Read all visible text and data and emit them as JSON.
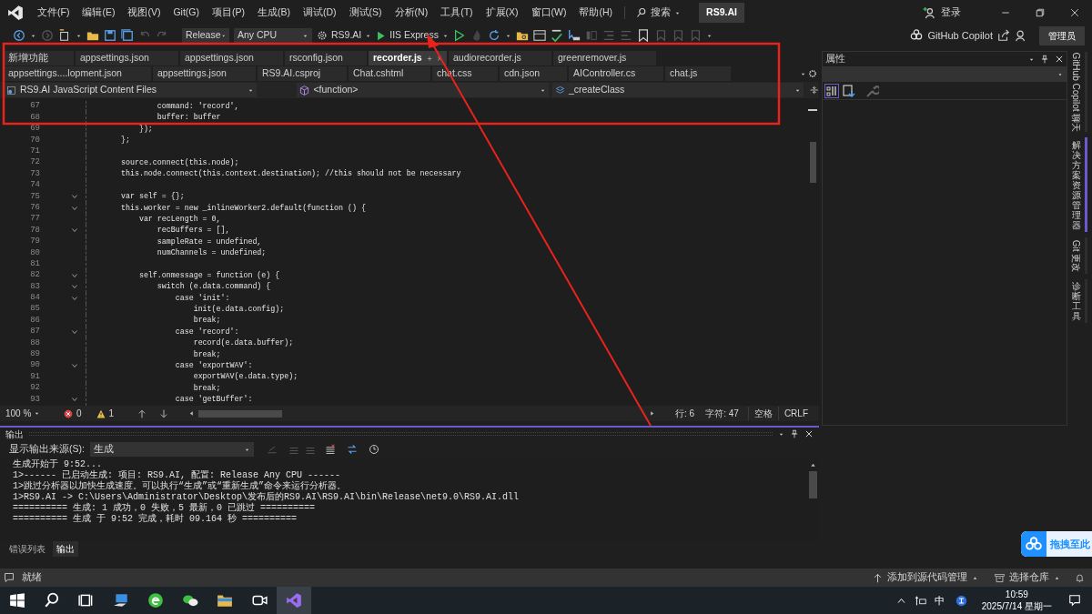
{
  "title_bar": {
    "menus": [
      "文件(F)",
      "编辑(E)",
      "视图(V)",
      "Git(G)",
      "项目(P)",
      "生成(B)",
      "调试(D)",
      "测试(S)",
      "分析(N)",
      "工具(T)",
      "扩展(X)",
      "窗口(W)",
      "帮助(H)"
    ],
    "search": "搜索",
    "solution": "RS9.AI",
    "sign_in": "登录"
  },
  "toolbar": {
    "configuration": "Release",
    "platform": "Any CPU",
    "startup_project": "RS9.AI",
    "run_target": "IIS Express",
    "copilot": "GitHub Copilot",
    "admin": "管理员"
  },
  "editor": {
    "tab_rows": [
      [
        {
          "label": "新增功能",
          "selected": false
        },
        {
          "label": "appsettings.json",
          "selected": false
        },
        {
          "label": "appsettings.json",
          "selected": false
        },
        {
          "label": "rsconfig.json",
          "selected": false
        },
        {
          "label": "recorder.js",
          "selected": true
        },
        {
          "label": "audiorecorder.js",
          "selected": false
        },
        {
          "label": "greenremover.js",
          "selected": false
        }
      ],
      [
        {
          "label": "appsettings....lopment.json",
          "selected": false
        },
        {
          "label": "appsettings.json",
          "selected": false
        },
        {
          "label": "RS9.AI.csproj",
          "selected": false
        },
        {
          "label": "Chat.cshtml",
          "selected": false
        },
        {
          "label": "chat.css",
          "selected": false
        },
        {
          "label": "cdn.json",
          "selected": false
        },
        {
          "label": "AIController.cs",
          "selected": false
        },
        {
          "label": "chat.js",
          "selected": false
        }
      ]
    ],
    "nav": {
      "project": "RS9.AI JavaScript Content Files",
      "scope": "<function>",
      "member": "_createClass"
    },
    "lines": [
      {
        "number": "67",
        "code": "        command: 'record',",
        "foldable": false
      },
      {
        "number": "68",
        "code": "        buffer: buffer",
        "foldable": false
      },
      {
        "number": "69",
        "code": "    });",
        "foldable": false
      },
      {
        "number": "70",
        "code": "};",
        "foldable": false
      },
      {
        "number": "71",
        "foldable": false
      },
      {
        "number": "72",
        "code": "source.connect(this.node);",
        "foldable": false
      },
      {
        "number": "73",
        "code": "this.node.connect(this.context.destination); //this should not be necessary",
        "foldable": false
      },
      {
        "number": "74",
        "foldable": false
      },
      {
        "number": "75",
        "code": "var self = {};",
        "foldable": true
      },
      {
        "number": "76",
        "code": "this.worker = new _inlineWorker2.default(function () {",
        "foldable": true
      },
      {
        "number": "77",
        "code": "    var recLength = 0,",
        "foldable": false
      },
      {
        "number": "78",
        "code": "        recBuffers = [],",
        "foldable": true
      },
      {
        "number": "79",
        "code": "        sampleRate = undefined,",
        "foldable": false
      },
      {
        "number": "80",
        "code": "        numChannels = undefined;",
        "foldable": false
      },
      {
        "number": "81",
        "foldable": false
      },
      {
        "number": "82",
        "code": "    self.onmessage = function (e) {",
        "foldable": true
      },
      {
        "number": "83",
        "code": "        switch (e.data.command) {",
        "foldable": true
      },
      {
        "number": "84",
        "code": "            case 'init':",
        "foldable": true
      },
      {
        "number": "85",
        "code": "                init(e.data.config);",
        "foldable": false
      },
      {
        "number": "86",
        "code": "                break;",
        "foldable": false
      },
      {
        "number": "87",
        "code": "            case 'record':",
        "foldable": true
      },
      {
        "number": "88",
        "code": "                record(e.data.buffer);",
        "foldable": false
      },
      {
        "number": "89",
        "code": "                break;",
        "foldable": false
      },
      {
        "number": "90",
        "code": "            case 'exportWAV':",
        "foldable": true
      },
      {
        "number": "91",
        "code": "                exportWAV(e.data.type);",
        "foldable": false
      },
      {
        "number": "92",
        "code": "                break;",
        "foldable": false
      },
      {
        "number": "93",
        "code": "            case 'getBuffer':",
        "foldable": true
      }
    ],
    "zoom": "100 %",
    "errors": "0",
    "warnings": "1",
    "line": "行: 6",
    "column": "字符: 47",
    "indent": "空格",
    "line_ending": "CRLF"
  },
  "output": {
    "title": "输出",
    "source_label": "显示输出来源(S):",
    "source": "生成",
    "lines": [
      "生成开始于 9:52...",
      "1>------ 已启动生成: 项目: RS9.AI, 配置: Release Any CPU ------",
      "1>跳过分析器以加快生成速度。可以执行“生成”或“重新生成”命令来运行分析器。",
      "1>RS9.AI -> C:\\Users\\Administrator\\Desktop\\发布后的RS9.AI\\RS9.AI\\bin\\Release\\net9.0\\RS9.AI.dll",
      "========== 生成: 1 成功，0 失败，5 最新，0 已跳过 ==========",
      "========== 生成 于 9:52 完成，耗时 09.164 秒 =========="
    ]
  },
  "bottom_tabs": [
    {
      "label": "错误列表",
      "selected": false
    },
    {
      "label": "输出",
      "selected": true
    }
  ],
  "properties": {
    "title": "属性"
  },
  "side_tabs": [
    {
      "label": "GitHub Copilot 聊天",
      "selected": false
    },
    {
      "label": "解决方案资源管理器",
      "selected": true
    },
    {
      "label": "Git 更改",
      "selected": false
    },
    {
      "label": "诊断工具",
      "selected": false
    }
  ],
  "upload_widget": {
    "label": "拖拽至此"
  },
  "status_bar": {
    "message": "就绪",
    "source_control": "添加到源代码管理",
    "repository": "选择仓库"
  },
  "taskbar": {
    "input_method": "中",
    "time": "10:59",
    "date": "2025/7/14 星期一"
  }
}
